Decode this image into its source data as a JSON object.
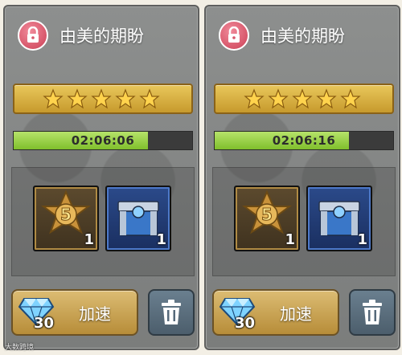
{
  "watermark": "大数跨境",
  "cards": [
    {
      "title": "由美的期盼",
      "timer": "02:06:06",
      "timer_progress": 0.75,
      "stars": 5,
      "items": [
        {
          "icon": "rank-5-star-badge-icon",
          "count": "1"
        },
        {
          "icon": "blue-supply-crate-icon",
          "count": "1"
        }
      ],
      "speed_label": "加速",
      "gem_cost": "30"
    },
    {
      "title": "由美的期盼",
      "timer": "02:06:16",
      "timer_progress": 0.75,
      "stars": 5,
      "items": [
        {
          "icon": "rank-5-star-badge-icon",
          "count": "1"
        },
        {
          "icon": "blue-supply-crate-icon",
          "count": "1"
        }
      ],
      "speed_label": "加速",
      "gem_cost": "30"
    }
  ]
}
